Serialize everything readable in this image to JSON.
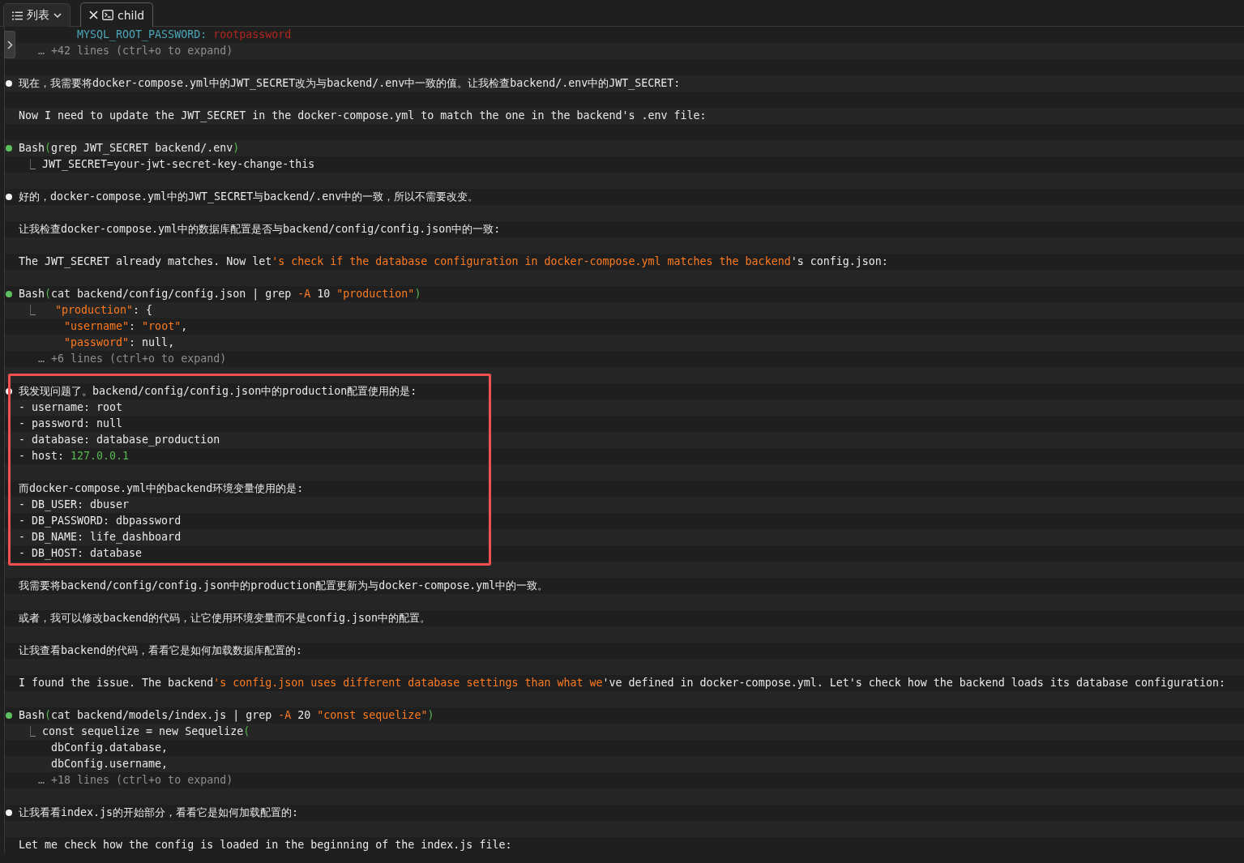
{
  "tabs": [
    {
      "kind": "menu",
      "label": "列表",
      "selected": false
    },
    {
      "kind": "terminal",
      "label": "child",
      "selected": true
    }
  ],
  "transcript": {
    "blocks": [
      {
        "highlighted": false,
        "lines": [
          {
            "kind": "text",
            "spans": [
              {
                "kind": "teal",
                "text": "         MYSQL_ROOT_PASSWORD: "
              },
              {
                "kind": "red",
                "text": "rootpassword"
              }
            ]
          },
          {
            "kind": "text",
            "spans": [
              {
                "kind": "gray",
                "text": "   … +42 lines (ctrl+o to expand)"
              }
            ]
          },
          {
            "kind": "blank"
          },
          {
            "kind": "message",
            "spans": [
              {
                "kind": "plain",
                "text": "现在，我需要将docker-compose.yml中的JWT_SECRET改为与backend/.env中一致的值。让我检查backend/.env中的JWT_SECRET:"
              }
            ]
          },
          {
            "kind": "blank"
          },
          {
            "kind": "text",
            "spans": [
              {
                "kind": "plain",
                "text": "Now I need to update the JWT_SECRET in the docker-compose.yml to match the one in the backend's .env file:"
              }
            ]
          },
          {
            "kind": "blank"
          },
          {
            "kind": "tool",
            "spans": [
              {
                "kind": "plain",
                "text": "Bash"
              },
              {
                "kind": "green",
                "text": "("
              },
              {
                "kind": "plain",
                "text": "grep JWT_SECRET backend/.env"
              },
              {
                "kind": "green",
                "text": ")"
              }
            ]
          },
          {
            "kind": "text",
            "spans": [
              {
                "kind": "gray",
                "text": " ⎿ "
              },
              {
                "kind": "plain",
                "text": "JWT_SECRET=your-jwt-secret-key-change-this"
              }
            ]
          },
          {
            "kind": "blank"
          },
          {
            "kind": "message",
            "spans": [
              {
                "kind": "plain",
                "text": "好的，docker-compose.yml中的JWT_SECRET与backend/.env中的一致，所以不需要改变。"
              }
            ]
          },
          {
            "kind": "blank"
          },
          {
            "kind": "text",
            "spans": [
              {
                "kind": "plain",
                "text": "让我检查docker-compose.yml中的数据库配置是否与backend/config/config.json中的一致:"
              }
            ]
          },
          {
            "kind": "blank"
          },
          {
            "kind": "text",
            "spans": [
              {
                "kind": "plain",
                "text": "The JWT_SECRET already matches. Now let"
              },
              {
                "kind": "orange",
                "text": "'s check if the database configuration in docker-compose.yml matches the backend"
              },
              {
                "kind": "plain",
                "text": "'s config.json:"
              }
            ]
          },
          {
            "kind": "blank"
          },
          {
            "kind": "tool",
            "spans": [
              {
                "kind": "plain",
                "text": "Bash"
              },
              {
                "kind": "green",
                "text": "("
              },
              {
                "kind": "plain",
                "text": "cat backend/config/config.json | grep "
              },
              {
                "kind": "orange",
                "text": "-A"
              },
              {
                "kind": "plain",
                "text": " 10 "
              },
              {
                "kind": "orange",
                "text": "\"production\""
              },
              {
                "kind": "green",
                "text": ")"
              }
            ]
          },
          {
            "kind": "text",
            "spans": [
              {
                "kind": "gray",
                "text": " ⎿   "
              },
              {
                "kind": "orange",
                "text": "\"production\""
              },
              {
                "kind": "plain",
                "text": ": {"
              }
            ]
          },
          {
            "kind": "text",
            "spans": [
              {
                "kind": "orange",
                "text": "       \"username\""
              },
              {
                "kind": "plain",
                "text": ": "
              },
              {
                "kind": "orange",
                "text": "\"root\""
              },
              {
                "kind": "plain",
                "text": ","
              }
            ]
          },
          {
            "kind": "text",
            "spans": [
              {
                "kind": "orange",
                "text": "       \"password\""
              },
              {
                "kind": "plain",
                "text": ": null,"
              }
            ]
          },
          {
            "kind": "text",
            "spans": [
              {
                "kind": "gray",
                "text": "   … +6 lines (ctrl+o to expand)"
              }
            ]
          },
          {
            "kind": "blank"
          }
        ]
      },
      {
        "highlighted": true,
        "lines": [
          {
            "kind": "message",
            "spans": [
              {
                "kind": "plain",
                "text": "我发现问题了。backend/config/config.json中的production配置使用的是:"
              }
            ]
          },
          {
            "kind": "text",
            "spans": [
              {
                "kind": "plain",
                "text": "- username: root"
              }
            ]
          },
          {
            "kind": "text",
            "spans": [
              {
                "kind": "plain",
                "text": "- password: null"
              }
            ]
          },
          {
            "kind": "text",
            "spans": [
              {
                "kind": "plain",
                "text": "- database: database_production"
              }
            ]
          },
          {
            "kind": "text",
            "spans": [
              {
                "kind": "plain",
                "text": "- host: "
              },
              {
                "kind": "green",
                "text": "127.0.0.1"
              }
            ]
          },
          {
            "kind": "blank"
          },
          {
            "kind": "text",
            "spans": [
              {
                "kind": "plain",
                "text": "而docker-compose.yml中的backend环境变量使用的是:"
              }
            ]
          },
          {
            "kind": "text",
            "spans": [
              {
                "kind": "plain",
                "text": "- DB_USER: dbuser"
              }
            ]
          },
          {
            "kind": "text",
            "spans": [
              {
                "kind": "plain",
                "text": "- DB_PASSWORD: dbpassword"
              }
            ]
          },
          {
            "kind": "text",
            "spans": [
              {
                "kind": "plain",
                "text": "- DB_NAME: life_dashboard"
              }
            ]
          },
          {
            "kind": "text",
            "spans": [
              {
                "kind": "plain",
                "text": "- DB_HOST: database"
              }
            ]
          }
        ]
      },
      {
        "highlighted": false,
        "lines": [
          {
            "kind": "blank"
          },
          {
            "kind": "text",
            "spans": [
              {
                "kind": "plain",
                "text": "我需要将backend/config/config.json中的production配置更新为与docker-compose.yml中的一致。"
              }
            ]
          },
          {
            "kind": "blank"
          },
          {
            "kind": "text",
            "spans": [
              {
                "kind": "plain",
                "text": "或者，我可以修改backend的代码，让它使用环境变量而不是config.json中的配置。"
              }
            ]
          },
          {
            "kind": "blank"
          },
          {
            "kind": "text",
            "spans": [
              {
                "kind": "plain",
                "text": "让我查看backend的代码，看看它是如何加载数据库配置的:"
              }
            ]
          },
          {
            "kind": "blank"
          },
          {
            "kind": "text",
            "spans": [
              {
                "kind": "plain",
                "text": "I found the issue. The backend"
              },
              {
                "kind": "orange",
                "text": "'s config.json uses different database settings than what we"
              },
              {
                "kind": "plain",
                "text": "'ve defined in docker-compose.yml. Let's check how the backend loads its database configuration:"
              }
            ]
          },
          {
            "kind": "blank"
          },
          {
            "kind": "tool",
            "spans": [
              {
                "kind": "plain",
                "text": "Bash"
              },
              {
                "kind": "green",
                "text": "("
              },
              {
                "kind": "plain",
                "text": "cat backend/models/index.js | grep "
              },
              {
                "kind": "orange",
                "text": "-A"
              },
              {
                "kind": "plain",
                "text": " 20 "
              },
              {
                "kind": "orange",
                "text": "\"const sequelize\""
              },
              {
                "kind": "green",
                "text": ")"
              }
            ]
          },
          {
            "kind": "text",
            "spans": [
              {
                "kind": "gray",
                "text": " ⎿ "
              },
              {
                "kind": "plain",
                "text": "const sequelize = new Sequelize"
              },
              {
                "kind": "green",
                "text": "("
              }
            ]
          },
          {
            "kind": "text",
            "spans": [
              {
                "kind": "plain",
                "text": "     dbConfig.database,"
              }
            ]
          },
          {
            "kind": "text",
            "spans": [
              {
                "kind": "plain",
                "text": "     dbConfig.username,"
              }
            ]
          },
          {
            "kind": "text",
            "spans": [
              {
                "kind": "gray",
                "text": "   … +18 lines (ctrl+o to expand)"
              }
            ]
          },
          {
            "kind": "blank"
          },
          {
            "kind": "message",
            "spans": [
              {
                "kind": "plain",
                "text": "让我看看index.js的开始部分，看看它是如何加载配置的:"
              }
            ]
          },
          {
            "kind": "blank"
          },
          {
            "kind": "text",
            "spans": [
              {
                "kind": "plain",
                "text": "Let me check how the config is loaded in the beginning of the index.js file:"
              }
            ]
          }
        ]
      }
    ]
  }
}
